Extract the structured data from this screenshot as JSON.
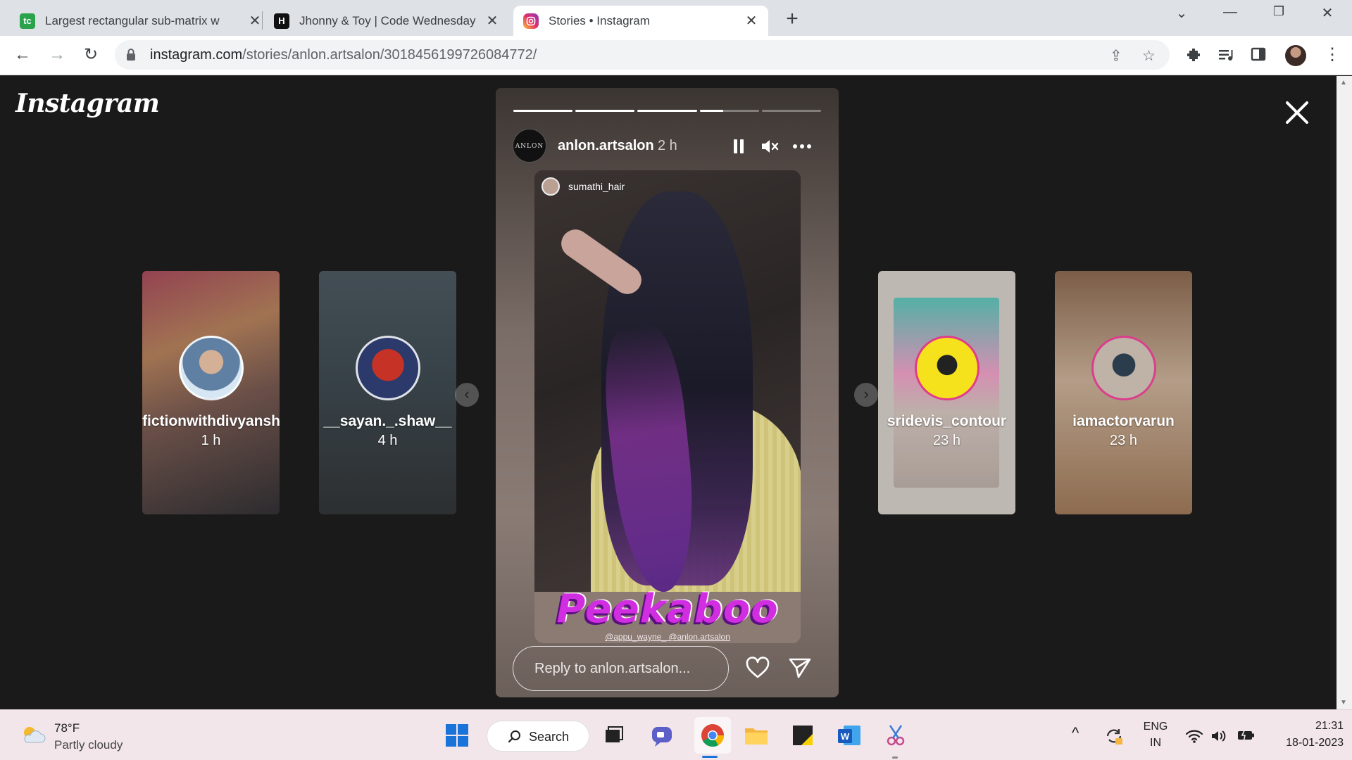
{
  "browser": {
    "tabs": [
      {
        "title": "Largest rectangular sub-matrix w",
        "favicon": "tc"
      },
      {
        "title": "Jhonny & Toy | Code Wednesday",
        "favicon": "H"
      },
      {
        "title": "Stories • Instagram",
        "favicon": "instagram-icon",
        "active": true
      }
    ],
    "url_host": "instagram.com",
    "url_path": "/stories/anlon.artsalon/3018456199726084772/"
  },
  "instagram": {
    "logo": "Instagram",
    "side_stories": [
      {
        "username": "fictionwithdivyansh",
        "time": "1 h"
      },
      {
        "username": "__sayan._.shaw__",
        "time": "4 h"
      },
      {
        "username": "sridevis_contour",
        "time": "23 h"
      },
      {
        "username": "iamactorvarun",
        "time": "23 h"
      }
    ],
    "story": {
      "username": "anlon.artsalon",
      "time": "2 h",
      "avatar_text": "ANLON",
      "progress": [
        1,
        1,
        1,
        0.4,
        0
      ],
      "tagged_user": "sumathi_hair",
      "headline": "Peekaboo",
      "credit": "@appu_wayne_ @anlon.artsalon",
      "reply_placeholder": "Reply to anlon.artsalon..."
    }
  },
  "taskbar": {
    "weather_temp": "78°F",
    "weather_desc": "Partly cloudy",
    "search_label": "Search",
    "lang_top": "ENG",
    "lang_bottom": "IN",
    "time": "21:31",
    "date": "18-01-2023"
  },
  "colors": {
    "ig_bg": "#1a1a1a",
    "peekaboo": "#d02ee0",
    "taskbar": "#f2e6ea"
  }
}
